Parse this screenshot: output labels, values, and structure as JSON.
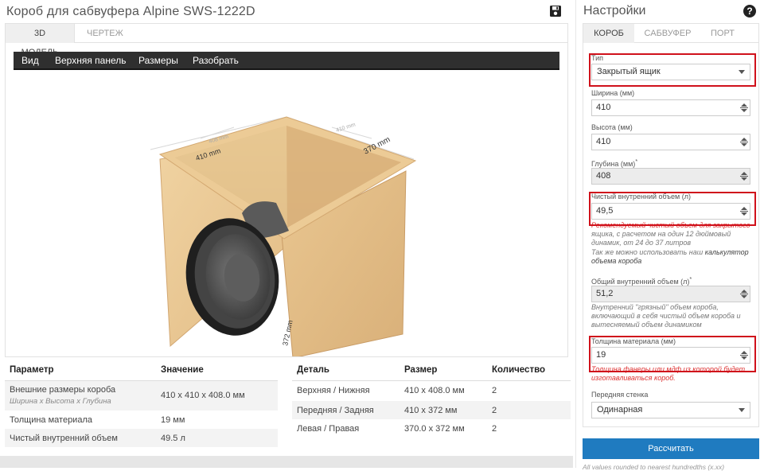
{
  "header": {
    "title": "Короб для сабвуфера Alpine SWS-1222D"
  },
  "main_tabs": [
    {
      "label": "3D модель"
    },
    {
      "label": "Чертеж"
    }
  ],
  "toolbar": {
    "items": [
      "Вид",
      "Верхняя панель",
      "Размеры",
      "Разобрать"
    ]
  },
  "model": {
    "dim_front": "410 mm",
    "dim_side": "370 mm",
    "dim_height": "372 mm",
    "dim_top_left": "408 mm",
    "dim_top_right": "410 mm"
  },
  "params_table": {
    "headers": [
      "Параметр",
      "Значение"
    ],
    "rows": [
      {
        "param": "Внешние размеры короба",
        "note": "Ширина х Высота х Глубина",
        "value": "410 x 410 x 408.0 мм"
      },
      {
        "param": "Толщина материала",
        "value": "19 мм"
      },
      {
        "param": "Чистый внутренний объем",
        "value": "49.5 л"
      }
    ]
  },
  "parts_table": {
    "headers": [
      "Деталь",
      "Размер",
      "Количество"
    ],
    "rows": [
      {
        "part": "Верхняя / Нижняя",
        "size": "410 x 408.0 мм",
        "qty": "2"
      },
      {
        "part": "Передняя / Задняя",
        "size": "410 x 372 мм",
        "qty": "2"
      },
      {
        "part": "Левая / Правая",
        "size": "370.0 x 372 мм",
        "qty": "2"
      }
    ]
  },
  "settings": {
    "title": "Настройки",
    "tabs": [
      "Короб",
      "Сабвуфер",
      "Порт"
    ],
    "type_label": "Тип",
    "type_value": "Закрытый ящик",
    "width_label": "Ширина (мм)",
    "width_value": "410",
    "height_label": "Высота (мм)",
    "height_value": "410",
    "depth_label": "Глубина (мм)",
    "depth_star": "*",
    "depth_value": "408",
    "net_volume_label": "Чистый внутренний объем (л)",
    "net_volume_value": "49,5",
    "net_volume_note_red": "Рекомендуемый чистый объем для закрытого",
    "net_volume_note": "ящика, с расчетом на один 12 дюймовый динамик, от 24 до 37 литров",
    "calc_note_prefix": "Так же можно использовать наш",
    "calc_note_link": "калькулятор объема короба",
    "gross_volume_label": "Общий внутренний объем (л)",
    "gross_star": "*",
    "gross_volume_value": "51,2",
    "gross_volume_note": "Внутренний \"грязный\" объем короба, включающий в себя чистый объем короба и вытесняемый объем динамиком",
    "thickness_label": "Толщина материала (мм)",
    "thickness_value": "19",
    "thickness_note": "Толщина фанеры или мдф из которой будет изготавливаться короб.",
    "front_wall_label": "Передняя стенка",
    "front_wall_value": "Одинарная",
    "calculate_label": "Рассчитать",
    "footnote": "All values rounded to nearest hundredths (x.xx)"
  },
  "colors": {
    "accent_blue": "#1f7bc0",
    "highlight_red": "#d0111b",
    "toolbar_dark": "#2f2f2f",
    "wood": "#e8c38f"
  },
  "icons": {
    "save": "floppy-disk-icon",
    "help": "question-circle-icon"
  }
}
